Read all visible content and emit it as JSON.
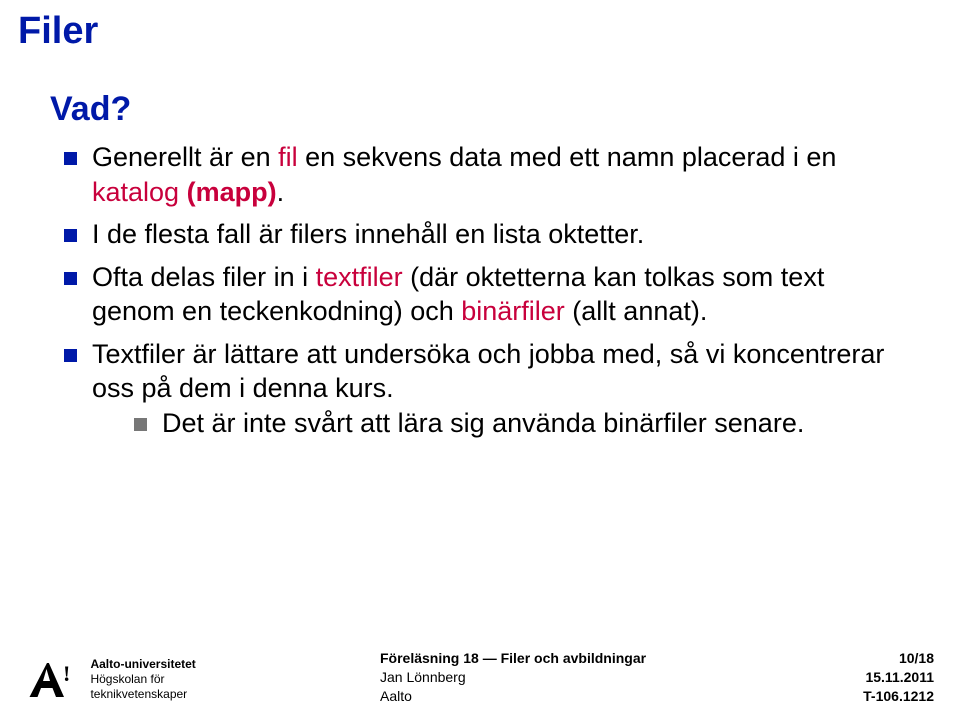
{
  "title": "Filer",
  "subtitle": "Vad?",
  "bullets": {
    "b1_pre": "Generellt är en ",
    "b1_hl1": "fil",
    "b1_mid": " en sekvens data med ett namn placerad i en ",
    "b1_hl2": "katalog",
    "b1_hl3": " (mapp)",
    "b1_post": ".",
    "b2": "I de flesta fall är filers innehåll en lista oktetter.",
    "b3_pre": "Ofta delas filer in i ",
    "b3_hl1": "textfiler",
    "b3_mid": " (där oktetterna kan tolkas som text genom en teckenkodning) och ",
    "b3_hl2": "binärfiler",
    "b3_post": " (allt annat).",
    "b4": "Textfiler är lättare att undersöka och jobba med, så vi koncentrerar oss på dem i denna kurs.",
    "b4_sub": "Det är inte svårt att lära sig använda binärfiler senare."
  },
  "footer": {
    "logo_line1": "Aalto-universitetet",
    "logo_line2": "Högskolan för",
    "logo_line3": "teknikvetenskaper",
    "center_lecture": "Föreläsning 18 — Filer och avbildningar",
    "center_author": "Jan Lönnberg",
    "center_org": "Aalto",
    "page": "10/18",
    "date": "15.11.2011",
    "course": "T-106.1212"
  }
}
